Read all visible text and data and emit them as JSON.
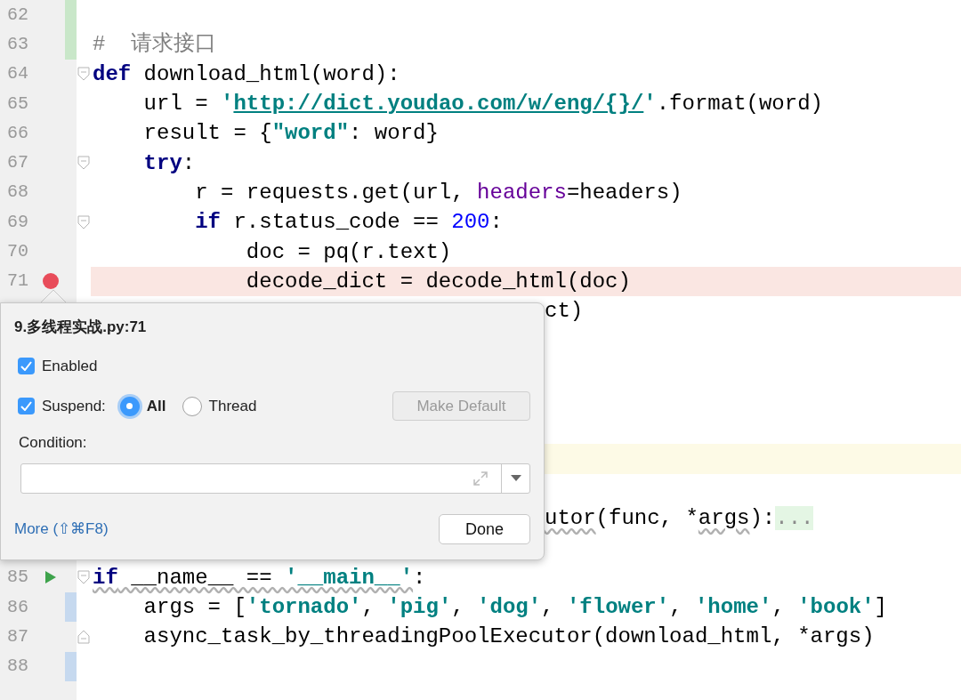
{
  "editor": {
    "lines": [
      {
        "kind": "code",
        "number": "62",
        "change": {
          "kind": "added"
        }
      },
      {
        "kind": "code",
        "number": "63",
        "change": {
          "kind": "added"
        },
        "tokens": [
          {
            "text": "#  请求接口",
            "kind": "comment"
          }
        ]
      },
      {
        "kind": "code",
        "number": "64",
        "fold": {
          "kind": "start"
        },
        "tokens": [
          {
            "text": "def",
            "kind": "keyword"
          },
          {
            "text": " download_html(word):",
            "kind": "plain"
          }
        ]
      },
      {
        "kind": "code",
        "number": "65",
        "tokens": [
          {
            "text": "    url = ",
            "kind": "plain"
          },
          {
            "text": "'",
            "kind": "string"
          },
          {
            "text": "http://dict.youdao.com/w/eng/{}/",
            "kind": "link"
          },
          {
            "text": "'",
            "kind": "string"
          },
          {
            "text": ".format(word)",
            "kind": "plain"
          }
        ]
      },
      {
        "kind": "code",
        "number": "66",
        "tokens": [
          {
            "text": "    result = {",
            "kind": "plain"
          },
          {
            "text": "\"word\"",
            "kind": "string"
          },
          {
            "text": ": word}",
            "kind": "plain"
          }
        ]
      },
      {
        "kind": "code",
        "number": "67",
        "fold": {
          "kind": "start"
        },
        "tokens": [
          {
            "text": "    try",
            "kind": "keyword"
          },
          {
            "text": ":",
            "kind": "plain"
          }
        ]
      },
      {
        "kind": "code",
        "number": "68",
        "tokens": [
          {
            "text": "        r = requests.get(url, ",
            "kind": "plain"
          },
          {
            "text": "headers",
            "kind": "param"
          },
          {
            "text": "=headers)",
            "kind": "plain"
          }
        ]
      },
      {
        "kind": "code",
        "number": "69",
        "fold": {
          "kind": "start"
        },
        "tokens": [
          {
            "text": "        if",
            "kind": "keyword"
          },
          {
            "text": " r.status_code == ",
            "kind": "plain"
          },
          {
            "text": "200",
            "kind": "number"
          },
          {
            "text": ":",
            "kind": "plain"
          }
        ]
      },
      {
        "kind": "code",
        "number": "70",
        "tokens": [
          {
            "text": "            doc = pq(r.text)",
            "kind": "plain"
          }
        ]
      },
      {
        "kind": "code",
        "number": "71",
        "marker": {
          "kind": "breakpoint"
        },
        "highlight": {
          "kind": "breakpoint"
        },
        "tokens": [
          {
            "text": "            decode_dict = decode_html(doc)",
            "kind": "plain"
          }
        ]
      },
      {
        "kind": "covered",
        "tokens": [
          {
            "text": "ct)",
            "kind": "plain"
          }
        ]
      },
      {
        "kind": "covered"
      },
      {
        "kind": "covered"
      },
      {
        "kind": "covered"
      },
      {
        "kind": "covered"
      },
      {
        "kind": "covered",
        "highlight": {
          "kind": "caret"
        }
      },
      {
        "kind": "covered"
      },
      {
        "kind": "covered",
        "tokens": [
          {
            "text": "utor",
            "kind": "plain",
            "warning": true
          },
          {
            "text": "(func, *",
            "kind": "plain",
            "warning": false
          },
          {
            "text": "args",
            "kind": "plain",
            "warning": true
          },
          {
            "text": "):",
            "kind": "plain",
            "warning": false
          },
          {
            "text": "...",
            "kind": "folded",
            "warning": false
          }
        ]
      },
      {
        "kind": "covered"
      },
      {
        "kind": "code",
        "number": "85",
        "marker": {
          "kind": "run"
        },
        "fold": {
          "kind": "start"
        },
        "tokens": [
          {
            "text": "if",
            "kind": "keyword",
            "warning": true
          },
          {
            "text": " __name__ == ",
            "kind": "plain",
            "warning": true
          },
          {
            "text": "'__main__'",
            "kind": "string",
            "warning": true
          },
          {
            "text": ":",
            "kind": "plain",
            "warning": false
          }
        ]
      },
      {
        "kind": "code",
        "number": "86",
        "change": {
          "kind": "modified"
        },
        "tokens": [
          {
            "text": "    args = [",
            "kind": "plain"
          },
          {
            "text": "'tornado'",
            "kind": "string"
          },
          {
            "text": ", ",
            "kind": "plain"
          },
          {
            "text": "'pig'",
            "kind": "string"
          },
          {
            "text": ", ",
            "kind": "plain"
          },
          {
            "text": "'dog'",
            "kind": "string"
          },
          {
            "text": ", ",
            "kind": "plain"
          },
          {
            "text": "'flower'",
            "kind": "string"
          },
          {
            "text": ", ",
            "kind": "plain"
          },
          {
            "text": "'home'",
            "kind": "string"
          },
          {
            "text": ", ",
            "kind": "plain"
          },
          {
            "text": "'book'",
            "kind": "string"
          },
          {
            "text": "]",
            "kind": "plain"
          }
        ]
      },
      {
        "kind": "code",
        "number": "87",
        "fold": {
          "kind": "end"
        },
        "tokens": [
          {
            "text": "    async_task_by_threadingPoolExecutor(download_html, *args)",
            "kind": "plain"
          }
        ]
      },
      {
        "kind": "code",
        "number": "88",
        "change": {
          "kind": "modified"
        }
      }
    ]
  },
  "breakpoint_popup": {
    "title": "9.多线程实战.py:71",
    "enabled": {
      "label": "Enabled",
      "checked": true
    },
    "suspend": {
      "label": "Suspend:",
      "checked": true,
      "options": [
        {
          "label": "All",
          "selected": true
        },
        {
          "label": "Thread",
          "selected": false
        }
      ]
    },
    "make_default": {
      "label": "Make Default",
      "disabled": true
    },
    "condition": {
      "label": "Condition:"
    },
    "more_link": "More (⇧⌘F8)",
    "done_button": "Done"
  }
}
